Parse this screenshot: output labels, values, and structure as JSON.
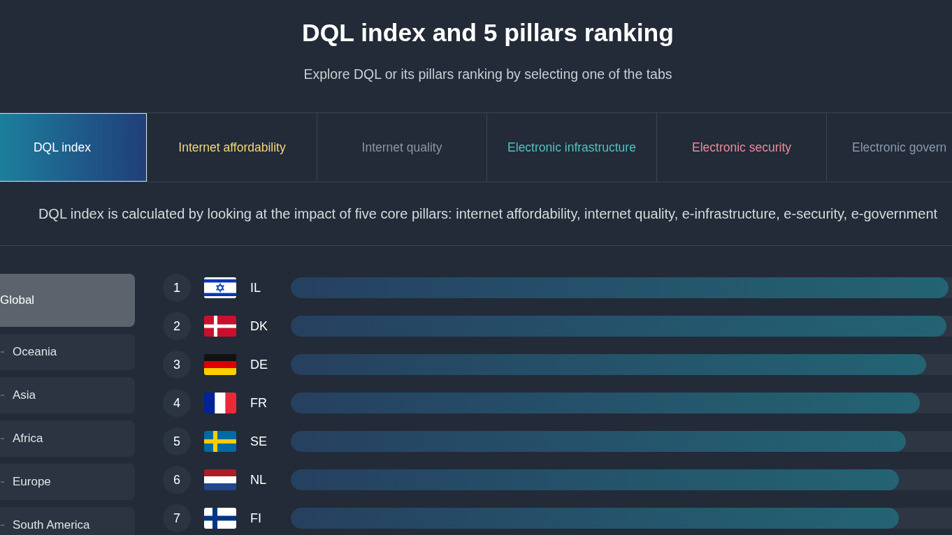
{
  "title": "DQL index and 5 pillars ranking",
  "subtitle": "Explore DQL or its pillars ranking by selecting one of the tabs",
  "tabs": [
    {
      "label": "DQL index",
      "selected": true
    },
    {
      "label": "Internet affordability",
      "selected": false,
      "color": "#f3d77a"
    },
    {
      "label": "Internet quality",
      "selected": false,
      "color": "#8f969f"
    },
    {
      "label": "Electronic infrastructure",
      "selected": false,
      "color": "#4fc3c0"
    },
    {
      "label": "Electronic security",
      "selected": false,
      "color": "#f08aa0"
    },
    {
      "label": "Electronic govern",
      "selected": false,
      "color": "#8b99ad"
    }
  ],
  "description": "DQL index is calculated by looking at the impact of five core pillars: internet affordability, internet quality, e-infrastructure, e-security, e-government",
  "sidebar": {
    "items": [
      {
        "label": "Global",
        "selected": true,
        "children": [
          {
            "label": "Oceania",
            "selected": false
          },
          {
            "label": "Asia",
            "selected": false
          },
          {
            "label": "Africa",
            "selected": false
          },
          {
            "label": "Europe",
            "selected": false
          },
          {
            "label": "South America",
            "selected": false
          }
        ]
      }
    ]
  },
  "rankings": [
    {
      "rank": "1",
      "code": "IL",
      "level": 0.93
    },
    {
      "rank": "2",
      "code": "DK",
      "level": 0.927
    },
    {
      "rank": "3",
      "code": "DE",
      "level": 0.898
    },
    {
      "rank": "4",
      "code": "FR",
      "level": 0.889
    },
    {
      "rank": "5",
      "code": "SE",
      "level": 0.87
    },
    {
      "rank": "6",
      "code": "NL",
      "level": 0.86
    },
    {
      "rank": "7",
      "code": "FI",
      "level": 0.86
    }
  ]
}
